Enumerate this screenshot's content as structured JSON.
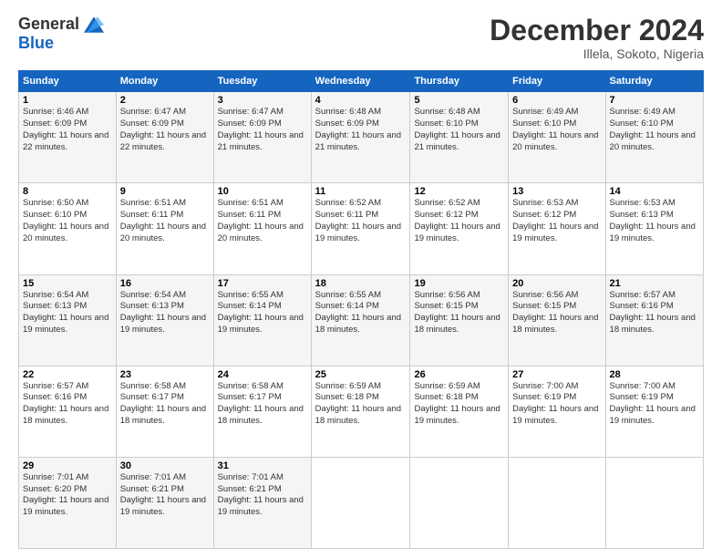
{
  "logo": {
    "general": "General",
    "blue": "Blue"
  },
  "title": "December 2024",
  "location": "Illela, Sokoto, Nigeria",
  "days_of_week": [
    "Sunday",
    "Monday",
    "Tuesday",
    "Wednesday",
    "Thursday",
    "Friday",
    "Saturday"
  ],
  "weeks": [
    [
      {
        "day": "1",
        "sunrise": "6:46 AM",
        "sunset": "6:09 PM",
        "daylight": "11 hours and 22 minutes."
      },
      {
        "day": "2",
        "sunrise": "6:47 AM",
        "sunset": "6:09 PM",
        "daylight": "11 hours and 22 minutes."
      },
      {
        "day": "3",
        "sunrise": "6:47 AM",
        "sunset": "6:09 PM",
        "daylight": "11 hours and 21 minutes."
      },
      {
        "day": "4",
        "sunrise": "6:48 AM",
        "sunset": "6:09 PM",
        "daylight": "11 hours and 21 minutes."
      },
      {
        "day": "5",
        "sunrise": "6:48 AM",
        "sunset": "6:10 PM",
        "daylight": "11 hours and 21 minutes."
      },
      {
        "day": "6",
        "sunrise": "6:49 AM",
        "sunset": "6:10 PM",
        "daylight": "11 hours and 20 minutes."
      },
      {
        "day": "7",
        "sunrise": "6:49 AM",
        "sunset": "6:10 PM",
        "daylight": "11 hours and 20 minutes."
      }
    ],
    [
      {
        "day": "8",
        "sunrise": "6:50 AM",
        "sunset": "6:10 PM",
        "daylight": "11 hours and 20 minutes."
      },
      {
        "day": "9",
        "sunrise": "6:51 AM",
        "sunset": "6:11 PM",
        "daylight": "11 hours and 20 minutes."
      },
      {
        "day": "10",
        "sunrise": "6:51 AM",
        "sunset": "6:11 PM",
        "daylight": "11 hours and 20 minutes."
      },
      {
        "day": "11",
        "sunrise": "6:52 AM",
        "sunset": "6:11 PM",
        "daylight": "11 hours and 19 minutes."
      },
      {
        "day": "12",
        "sunrise": "6:52 AM",
        "sunset": "6:12 PM",
        "daylight": "11 hours and 19 minutes."
      },
      {
        "day": "13",
        "sunrise": "6:53 AM",
        "sunset": "6:12 PM",
        "daylight": "11 hours and 19 minutes."
      },
      {
        "day": "14",
        "sunrise": "6:53 AM",
        "sunset": "6:13 PM",
        "daylight": "11 hours and 19 minutes."
      }
    ],
    [
      {
        "day": "15",
        "sunrise": "6:54 AM",
        "sunset": "6:13 PM",
        "daylight": "11 hours and 19 minutes."
      },
      {
        "day": "16",
        "sunrise": "6:54 AM",
        "sunset": "6:13 PM",
        "daylight": "11 hours and 19 minutes."
      },
      {
        "day": "17",
        "sunrise": "6:55 AM",
        "sunset": "6:14 PM",
        "daylight": "11 hours and 19 minutes."
      },
      {
        "day": "18",
        "sunrise": "6:55 AM",
        "sunset": "6:14 PM",
        "daylight": "11 hours and 18 minutes."
      },
      {
        "day": "19",
        "sunrise": "6:56 AM",
        "sunset": "6:15 PM",
        "daylight": "11 hours and 18 minutes."
      },
      {
        "day": "20",
        "sunrise": "6:56 AM",
        "sunset": "6:15 PM",
        "daylight": "11 hours and 18 minutes."
      },
      {
        "day": "21",
        "sunrise": "6:57 AM",
        "sunset": "6:16 PM",
        "daylight": "11 hours and 18 minutes."
      }
    ],
    [
      {
        "day": "22",
        "sunrise": "6:57 AM",
        "sunset": "6:16 PM",
        "daylight": "11 hours and 18 minutes."
      },
      {
        "day": "23",
        "sunrise": "6:58 AM",
        "sunset": "6:17 PM",
        "daylight": "11 hours and 18 minutes."
      },
      {
        "day": "24",
        "sunrise": "6:58 AM",
        "sunset": "6:17 PM",
        "daylight": "11 hours and 18 minutes."
      },
      {
        "day": "25",
        "sunrise": "6:59 AM",
        "sunset": "6:18 PM",
        "daylight": "11 hours and 18 minutes."
      },
      {
        "day": "26",
        "sunrise": "6:59 AM",
        "sunset": "6:18 PM",
        "daylight": "11 hours and 19 minutes."
      },
      {
        "day": "27",
        "sunrise": "7:00 AM",
        "sunset": "6:19 PM",
        "daylight": "11 hours and 19 minutes."
      },
      {
        "day": "28",
        "sunrise": "7:00 AM",
        "sunset": "6:19 PM",
        "daylight": "11 hours and 19 minutes."
      }
    ],
    [
      {
        "day": "29",
        "sunrise": "7:01 AM",
        "sunset": "6:20 PM",
        "daylight": "11 hours and 19 minutes."
      },
      {
        "day": "30",
        "sunrise": "7:01 AM",
        "sunset": "6:21 PM",
        "daylight": "11 hours and 19 minutes."
      },
      {
        "day": "31",
        "sunrise": "7:01 AM",
        "sunset": "6:21 PM",
        "daylight": "11 hours and 19 minutes."
      },
      null,
      null,
      null,
      null
    ]
  ]
}
